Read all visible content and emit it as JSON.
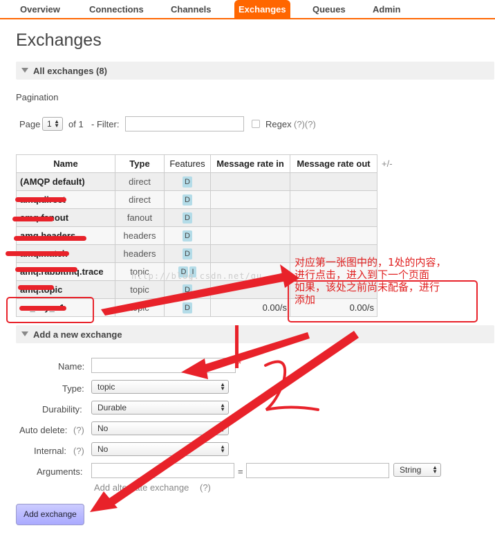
{
  "nav": {
    "tabs": [
      {
        "label": "Overview"
      },
      {
        "label": "Connections"
      },
      {
        "label": "Channels"
      },
      {
        "label": "Exchanges"
      },
      {
        "label": "Queues"
      },
      {
        "label": "Admin"
      }
    ],
    "active": "Exchanges"
  },
  "page_title": "Exchanges",
  "all_exchanges": {
    "header": "All exchanges (8)",
    "pagination_label": "Pagination",
    "page_label": "Page",
    "page_value": "1",
    "of_label": "of 1",
    "filter_label": "- Filter:",
    "filter_value": "",
    "regex_label": "Regex",
    "regex_hint": "(?)(?)",
    "columns": [
      "Name",
      "Type",
      "Features",
      "Message rate in",
      "Message rate out"
    ],
    "plus_minus": "+/-",
    "rows": [
      {
        "name": "(AMQP default)",
        "type": "direct",
        "features": [
          "D"
        ],
        "rate_in": "",
        "rate_out": ""
      },
      {
        "name": "amq.direct",
        "type": "direct",
        "features": [
          "D"
        ],
        "rate_in": "",
        "rate_out": ""
      },
      {
        "name": "amq.fanout",
        "type": "fanout",
        "features": [
          "D"
        ],
        "rate_in": "",
        "rate_out": ""
      },
      {
        "name": "amq.headers",
        "type": "headers",
        "features": [
          "D"
        ],
        "rate_in": "",
        "rate_out": ""
      },
      {
        "name": "amq.match",
        "type": "headers",
        "features": [
          "D"
        ],
        "rate_in": "",
        "rate_out": ""
      },
      {
        "name": "amq.rabbitmq.trace",
        "type": "topic",
        "features": [
          "D",
          "I"
        ],
        "rate_in": "",
        "rate_out": ""
      },
      {
        "name": "amq.topic",
        "type": "topic",
        "features": [
          "D"
        ],
        "rate_in": "",
        "rate_out": ""
      },
      {
        "name": "ex_zcy_v1",
        "type": "topic",
        "features": [
          "D"
        ],
        "rate_in": "0.00/s",
        "rate_out": "0.00/s"
      }
    ]
  },
  "add_exchange": {
    "header": "Add a new exchange",
    "name_label": "Name:",
    "name_value": "",
    "required_mark": "*",
    "type_label": "Type:",
    "type_value": "topic",
    "durability_label": "Durability:",
    "durability_value": "Durable",
    "auto_delete_label": "Auto delete:",
    "auto_delete_hint": "(?)",
    "auto_delete_value": "No",
    "internal_label": "Internal:",
    "internal_hint": "(?)",
    "internal_value": "No",
    "arguments_label": "Arguments:",
    "arguments_eq": "=",
    "arguments_type": "String",
    "alternate_label": "Add alternate exchange",
    "alternate_hint": "(?)",
    "submit_label": "Add exchange"
  },
  "annotations": {
    "note_text_1": "对应第一张图中的，1处的内容，",
    "note_text_2": "进行点击，进入到下一个页面",
    "note_text_3": "如果，该处之前尚未配备，进行",
    "note_text_4": "添加",
    "watermark": "http://blog.csdn.net/gu...88",
    "color": "#e8222a"
  }
}
